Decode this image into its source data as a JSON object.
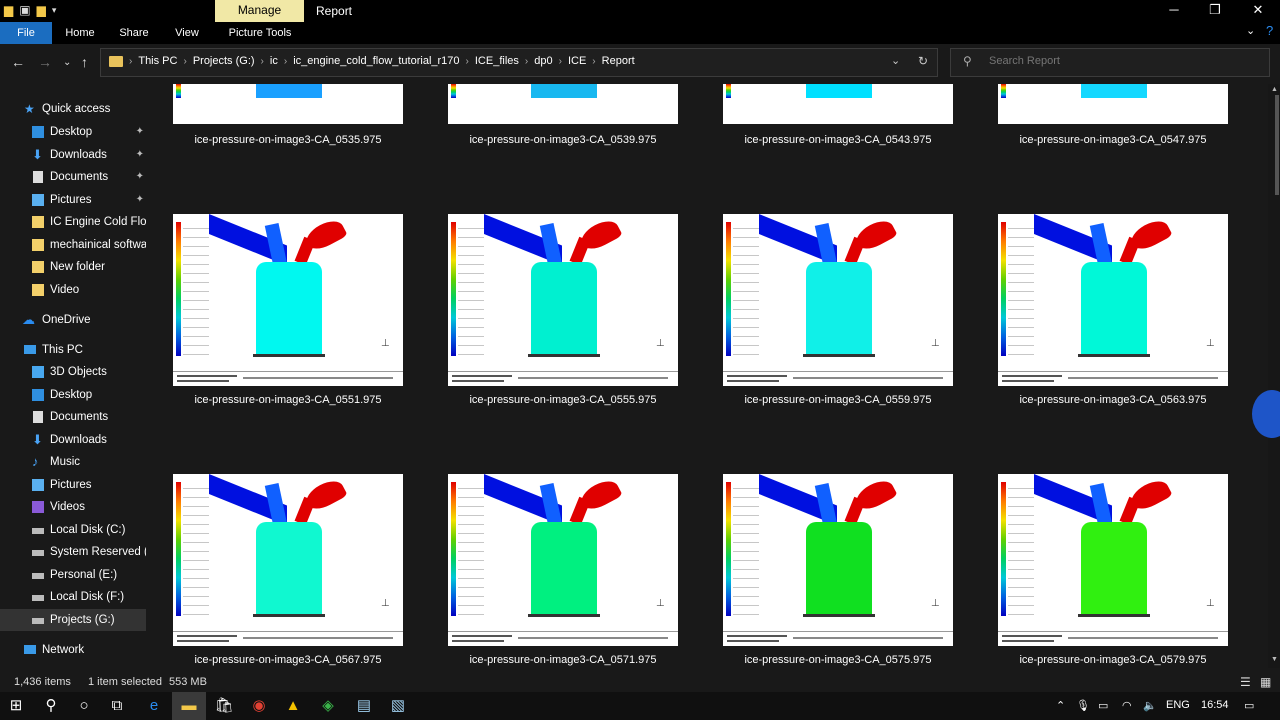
{
  "window": {
    "context_tab": "Manage",
    "title": "Report"
  },
  "ribbon": {
    "tabs": [
      "File",
      "Home",
      "Share",
      "View",
      "Picture Tools"
    ]
  },
  "address": {
    "crumbs": [
      "This PC",
      "Projects (G:)",
      "ic",
      "ic_engine_cold_flow_tutorial_r170",
      "ICE_files",
      "dp0",
      "ICE",
      "Report"
    ]
  },
  "search": {
    "placeholder": "Search Report"
  },
  "sidebar": {
    "quick_access": "Quick access",
    "quick_items": [
      "Desktop",
      "Downloads",
      "Documents",
      "Pictures",
      "IC Engine Cold Flow",
      "mechainical softwa",
      "New folder",
      "Video"
    ],
    "onedrive": "OneDrive",
    "this_pc": "This PC",
    "pc_items": [
      "3D Objects",
      "Desktop",
      "Documents",
      "Downloads",
      "Music",
      "Pictures",
      "Videos",
      "Local Disk (C:)",
      "System Reserved (D",
      "Personal (E:)",
      "Local Disk (F:)",
      "Projects (G:)"
    ],
    "network": "Network"
  },
  "files": {
    "top_row": [
      "ice-pressure-on-image3-CA_0535.975",
      "ice-pressure-on-image3-CA_0539.975",
      "ice-pressure-on-image3-CA_0543.975",
      "ice-pressure-on-image3-CA_0547.975"
    ],
    "mid_row": [
      "ice-pressure-on-image3-CA_0551.975",
      "ice-pressure-on-image3-CA_0555.975",
      "ice-pressure-on-image3-CA_0559.975",
      "ice-pressure-on-image3-CA_0563.975"
    ],
    "bottom_row": [
      "ice-pressure-on-image3-CA_0567.975",
      "ice-pressure-on-image3-CA_0571.975",
      "ice-pressure-on-image3-CA_0575.975",
      "ice-pressure-on-image3-CA_0579.975"
    ],
    "cylinder_colors": {
      "top_row": [
        "#1aa0ff",
        "#18b8f0",
        "#00e0ff",
        "#14d8ff"
      ],
      "mid_row": [
        "#00f8f0",
        "#00f0d0",
        "#10f0e8",
        "#00f8d8"
      ],
      "bottom_row": [
        "#10f8d0",
        "#00f080",
        "#10e020",
        "#30f010"
      ]
    }
  },
  "status": {
    "count": "1,436 items",
    "selected": "1 item selected",
    "size": "553 MB"
  },
  "taskbar": {
    "lang": "ENG",
    "time": "16:54"
  }
}
